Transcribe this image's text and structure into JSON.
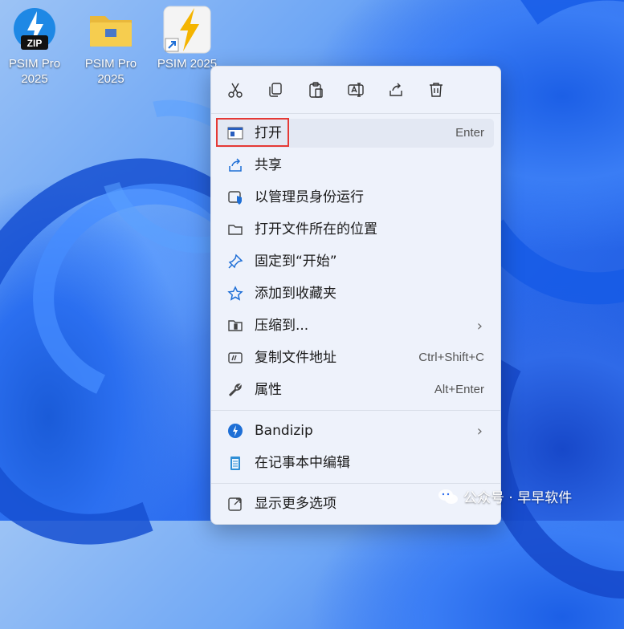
{
  "desktop": {
    "icons": [
      {
        "label": "PSIM Pro\n2025",
        "icon": "zip-archive-icon"
      },
      {
        "label": "PSIM Pro\n2025",
        "icon": "folder-icon"
      },
      {
        "label": "PSIM 2025",
        "icon": "psim-lightning-icon"
      }
    ]
  },
  "toolbar": {
    "buttons": [
      {
        "name": "cut",
        "icon": "scissors-icon"
      },
      {
        "name": "copy",
        "icon": "copy-icon"
      },
      {
        "name": "paste",
        "icon": "paste-icon"
      },
      {
        "name": "rename",
        "icon": "rename-icon"
      },
      {
        "name": "share",
        "icon": "share-icon"
      },
      {
        "name": "delete",
        "icon": "trash-icon"
      }
    ]
  },
  "menu": {
    "items": [
      {
        "label": "打开",
        "shortcut": "Enter",
        "icon": "open-icon"
      },
      {
        "label": "共享",
        "shortcut": "",
        "icon": "share-icon"
      },
      {
        "label": "以管理员身份运行",
        "shortcut": "",
        "icon": "shield-icon"
      },
      {
        "label": "打开文件所在的位置",
        "shortcut": "",
        "icon": "folder-icon"
      },
      {
        "label": "固定到“开始”",
        "shortcut": "",
        "icon": "pin-icon"
      },
      {
        "label": "添加到收藏夹",
        "shortcut": "",
        "icon": "star-icon"
      },
      {
        "label": "压缩到...",
        "shortcut": "",
        "icon": "compress-icon",
        "submenu": "›"
      },
      {
        "label": "复制文件地址",
        "shortcut": "Ctrl+Shift+C",
        "icon": "copy-path-icon"
      },
      {
        "label": "属性",
        "shortcut": "Alt+Enter",
        "icon": "wrench-icon"
      },
      {
        "label": "Bandizip",
        "shortcut": "",
        "icon": "bandizip-icon",
        "submenu": "›"
      },
      {
        "label": "在记事本中编辑",
        "shortcut": "",
        "icon": "notepad-icon"
      },
      {
        "label": "显示更多选项",
        "shortcut": "",
        "icon": "more-options-icon"
      }
    ]
  },
  "watermark": {
    "text": "公众号 · 早早软件"
  },
  "colors": {
    "highlight_border": "#e53935",
    "accent": "#1f6fd6",
    "menu_bg": "#eef2fb"
  }
}
